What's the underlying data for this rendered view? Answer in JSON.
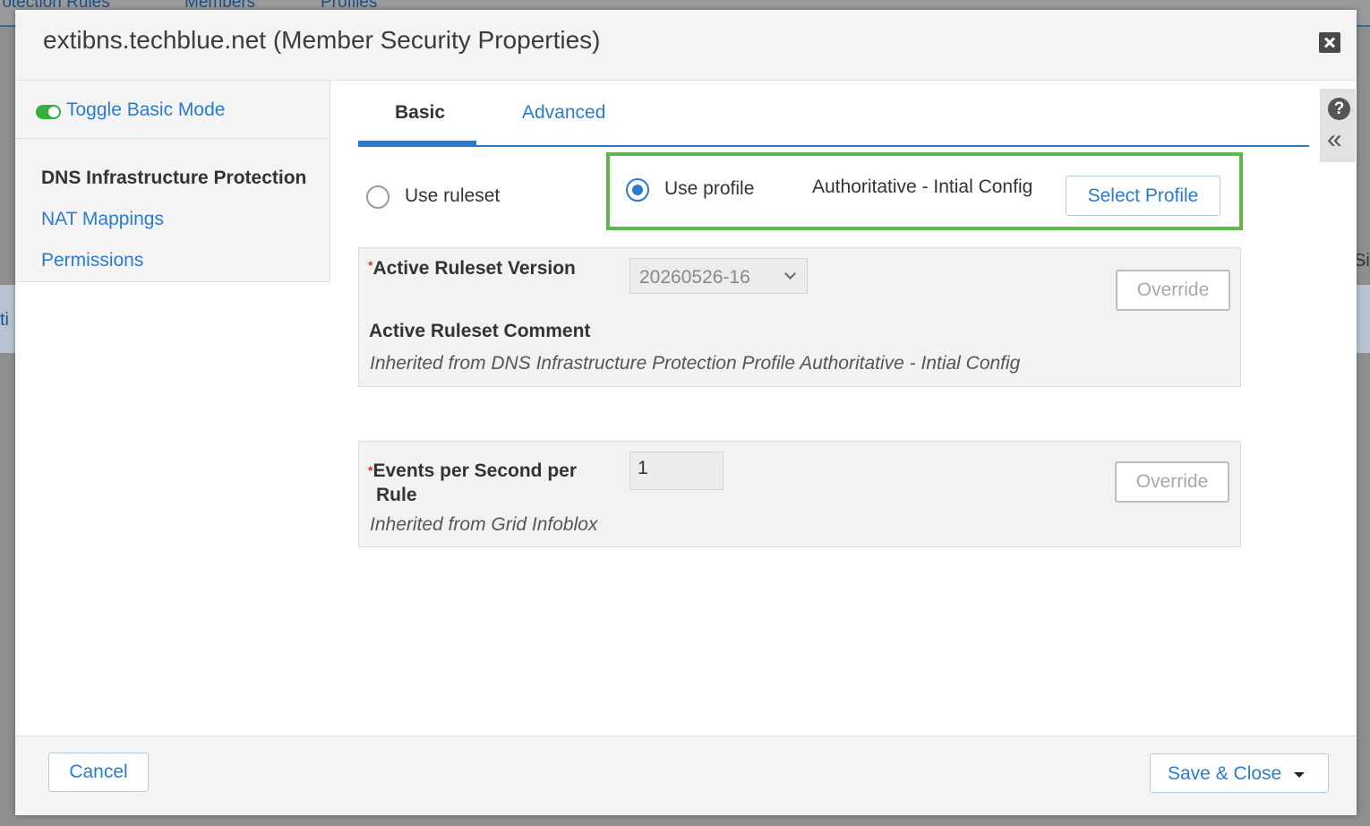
{
  "background": {
    "tabs": [
      "rotection Rules",
      "Members",
      "Profiles"
    ],
    "fragment_left": "ti",
    "fragment_right": "Si"
  },
  "dialog": {
    "title": "extibns.techblue.net (Member Security Properties)"
  },
  "sidenav": {
    "toggle_label": "Toggle Basic Mode",
    "items": [
      {
        "label": "DNS Infrastructure Protection",
        "active": true
      },
      {
        "label": "NAT Mappings",
        "active": false
      },
      {
        "label": "Permissions",
        "active": false
      }
    ]
  },
  "tabs": {
    "basic": "Basic",
    "advanced": "Advanced"
  },
  "mode": {
    "use_ruleset_label": "Use ruleset",
    "use_profile_label": "Use profile",
    "selected": "use_profile",
    "profile_name": "Authoritative - Intial Config",
    "select_profile_label": "Select Profile"
  },
  "ruleset_panel": {
    "required_mark": "*",
    "version_label": "Active Ruleset Version",
    "version_value": "20260526-16",
    "override_label": "Override",
    "comment_label": "Active Ruleset Comment",
    "comment_inherited": "Inherited from DNS Infrastructure Protection Profile Authoritative - Intial Config"
  },
  "events_panel": {
    "required_mark": "*",
    "label_line1": "Events per Second per",
    "label_line2": "Rule",
    "value": "1",
    "override_label": "Override",
    "inherited": "Inherited from Grid Infoblox"
  },
  "footer": {
    "cancel_label": "Cancel",
    "save_close_label": "Save & Close"
  },
  "colors": {
    "link_blue": "#2a7bd0",
    "highlight_green": "#5cb848",
    "toggle_green": "#37b03f",
    "required_red": "#d9342b"
  }
}
